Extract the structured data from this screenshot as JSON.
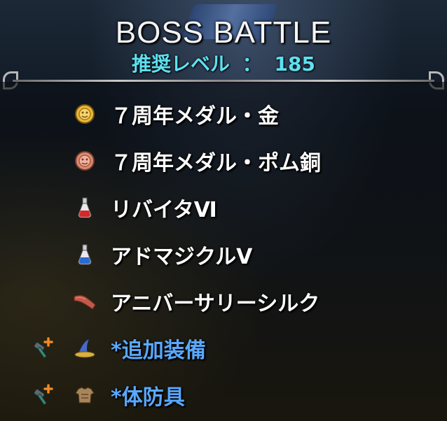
{
  "header": {
    "title": "BOSS BATTLE",
    "level_label": "推奨レベル",
    "level_sep": "：",
    "level_value": "185"
  },
  "rewards": [
    {
      "label": "７周年メダル・金",
      "icon": "gold-medal-icon"
    },
    {
      "label": "７周年メダル・ポム銅",
      "icon": "bronze-pom-medal-icon"
    },
    {
      "label": "リバイタⅥ",
      "icon": "red-potion-icon"
    },
    {
      "label": "アドマジクルⅤ",
      "icon": "blue-potion-icon"
    },
    {
      "label": "アニバーサリーシルク",
      "icon": "silk-cloth-icon"
    }
  ],
  "extras": [
    {
      "label": "*追加装備",
      "icon": "wizard-hat-icon"
    },
    {
      "label": "*体防具",
      "icon": "body-armor-icon"
    }
  ],
  "colors": {
    "level": "#5ee0f0",
    "extra_label": "#5aa8ff"
  }
}
